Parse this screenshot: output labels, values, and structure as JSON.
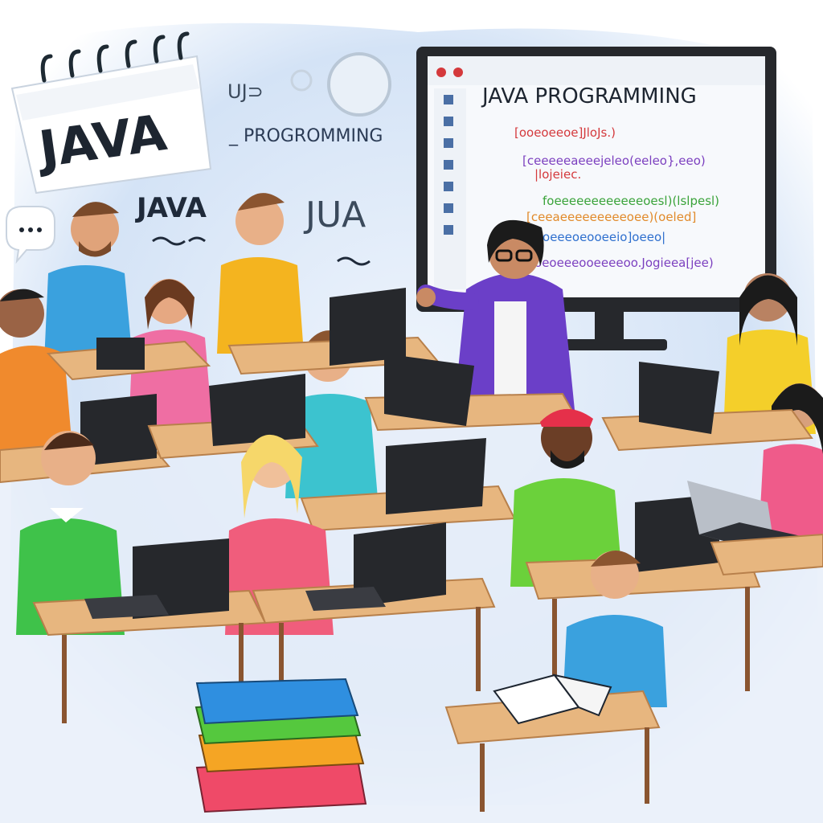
{
  "calendar": {
    "label": "JAVA"
  },
  "wall_text": {
    "uj": "UJ⊃",
    "programming": "_ PROGROMMING",
    "java": "JAVA",
    "jua": "JUA"
  },
  "monitor": {
    "title": "JAVA PROGRAMMING",
    "code_lines": [
      "[ooeoeeoe]JloJs.)",
      "[ceeeeeaeeejeleo(eeleo},eeo)",
      "|lojeiec.",
      "foeeeeeeeeeeeeoesl)(lslpesl)",
      "[ceeaeeeeeeeeeoee)(oeled]",
      "[ooeeeoeooeeio]oeeo|",
      "[ooeoeeeooeeeeoo.Jogieea[jee)"
    ]
  },
  "colors": {
    "background_wash": "#d7e5f7",
    "desk": "#e7b67f",
    "desk_edge": "#b8804b",
    "screen_frame": "#26282c",
    "code_green": "#3aa33a",
    "code_red": "#d4393c",
    "code_purple": "#7b3fbf",
    "code_orange": "#e18a2a",
    "code_blue": "#2e6fce"
  }
}
